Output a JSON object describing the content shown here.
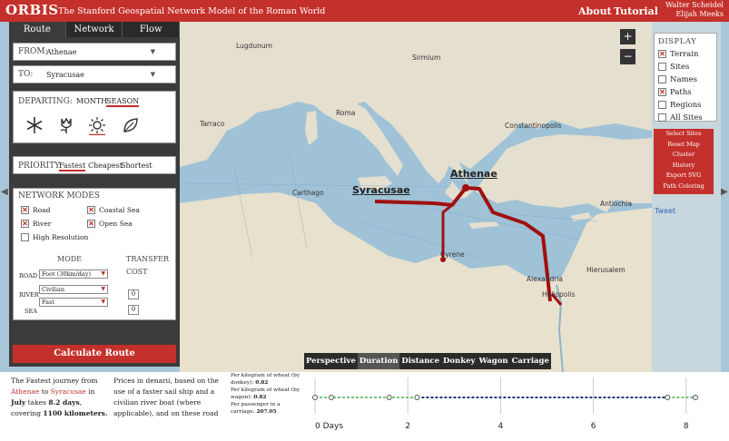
{
  "header": {
    "brand": "ORBIS",
    "subtitle": "The Stanford Geospatial Network Model of the Roman World",
    "nav_about": "About",
    "nav_tutorial": "Tutorial",
    "author1": "Walter Scheidel",
    "author2": "Elijah Meeks"
  },
  "tabs": [
    "Route",
    "Network",
    "Flow"
  ],
  "from": {
    "label": "FROM:",
    "value": "Athenae"
  },
  "to": {
    "label": "TO:",
    "value": "Syracusae"
  },
  "departing": {
    "label": "DEPARTING:",
    "month": "MONTH",
    "season": "SEASON"
  },
  "priority": {
    "label": "PRIORITY:",
    "options": [
      "Fastest",
      "Cheapest",
      "Shortest"
    ]
  },
  "network_modes": {
    "title": "NETWORK MODES",
    "road": "Road",
    "coastal_sea": "Coastal Sea",
    "river": "River",
    "open_sea": "Open Sea",
    "high_res": "High Resolution"
  },
  "mode_table": {
    "mode": "MODE",
    "transfer": "TRANSFER",
    "cost": "COST",
    "road": "ROAD",
    "river": "RIVER",
    "sea": "SEA",
    "road_val": "Foot (30km/day)",
    "river_val": "Civilian",
    "sea_val": "Fast",
    "cost1": "0",
    "cost2": "0"
  },
  "calc_button": "Calculate Route",
  "map": {
    "zoom_in": "+",
    "zoom_out": "−",
    "cities": {
      "lugdunum": "Lugdunum",
      "sirmium": "Sirmium",
      "tarraco": "Tarraco",
      "roma": "Roma",
      "constantinopolis": "Constantinopolis",
      "carthago": "Carthago",
      "syracusae": "Syracusae",
      "athenae": "Athenae",
      "antiochia": "Antiochia",
      "cyrene": "Cyrene",
      "alexandria": "Alexandria",
      "hierusalem": "Hierusalem",
      "heliopolis": "Heliopolis"
    }
  },
  "display": {
    "title": "DISPLAY",
    "items": [
      {
        "label": "Terrain",
        "checked": true
      },
      {
        "label": "Sites",
        "checked": false
      },
      {
        "label": "Names",
        "checked": false
      },
      {
        "label": "Paths",
        "checked": true
      },
      {
        "label": "Regions",
        "checked": false
      },
      {
        "label": "All Sites",
        "checked": false
      }
    ],
    "actions": [
      "Select Sites",
      "Reset Map",
      "Cluster",
      "History",
      "Export SVG",
      "Path Coloring"
    ],
    "tweet": "Tweet"
  },
  "summary": {
    "line1": "The Fastest journey from",
    "from": "Athenae",
    "to_word": "to",
    "to": "Syracusae",
    "in": "in",
    "month": "July",
    "takes": "takes",
    "days": "8.2 days",
    "covering": ", covering",
    "km": "1100 kilometers."
  },
  "prices": "Prices in denarii, based on the use of a faster sail ship and a civilian river boat (where applicable), and on these road",
  "wheat": [
    {
      "label": "Per kilogram of wheat (by donkey):",
      "value": "0.82"
    },
    {
      "label": "Per kilogram of wheat (by wagon):",
      "value": "0.82"
    },
    {
      "label": "Per passenger in a carriage:",
      "value": "207.05"
    }
  ],
  "chart_tabs": [
    "Perspective",
    "Duration",
    "Distance",
    "Donkey",
    "Wagon",
    "Carriage"
  ],
  "chart_data": {
    "type": "line",
    "xlabel": "",
    "tick_labels": [
      "0 Days",
      "2",
      "4",
      "6",
      "8"
    ],
    "x_ticks": [
      0,
      2,
      4,
      6,
      8
    ],
    "xlim": [
      0,
      8.2
    ],
    "stops": [
      0,
      0.35,
      1.6,
      2.2,
      7.6,
      8.2
    ]
  }
}
